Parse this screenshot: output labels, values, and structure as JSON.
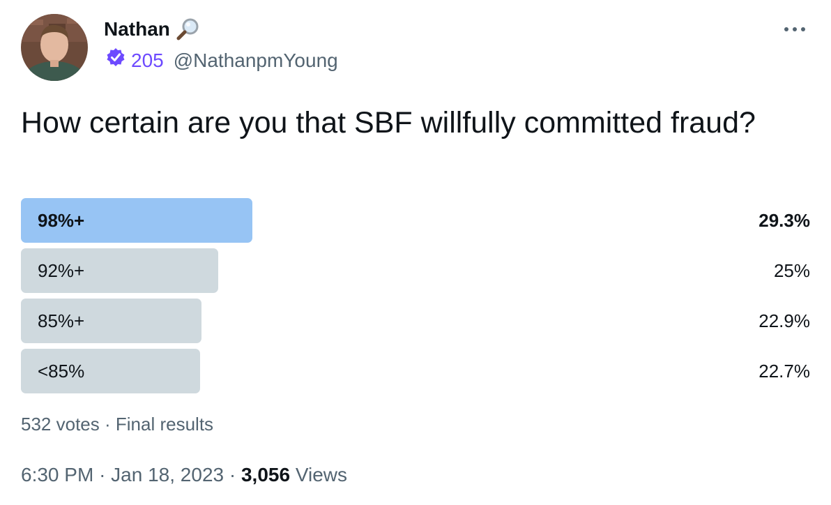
{
  "tweet": {
    "author": {
      "name": "Nathan",
      "name_icon": "magnifying-glass-icon",
      "badge_icon": "verified-badge-icon",
      "badge_count": "205",
      "handle": "@NathanpmYoung"
    },
    "more_icon": "more-options-icon",
    "question": "How certain are you that SBF willfully committed fraud?",
    "poll": {
      "options": [
        {
          "label": "98%+",
          "percent_text": "29.3%",
          "percent": 29.3,
          "winner": true
        },
        {
          "label": "92%+",
          "percent_text": "25%",
          "percent": 25,
          "winner": false
        },
        {
          "label": "85%+",
          "percent_text": "22.9%",
          "percent": 22.9,
          "winner": false
        },
        {
          "label": "<85%",
          "percent_text": "22.7%",
          "percent": 22.7,
          "winner": false
        }
      ],
      "votes": "532 votes",
      "separator": "·",
      "status": "Final results"
    },
    "time": "6:30 PM",
    "date": "Jan 18, 2023",
    "views_count": "3,056",
    "views_label": "Views",
    "colors": {
      "winner_bar": "#97c4f4",
      "other_bar": "#cfd9de",
      "secondary_text": "#536471",
      "badge": "#6d4aff"
    }
  }
}
